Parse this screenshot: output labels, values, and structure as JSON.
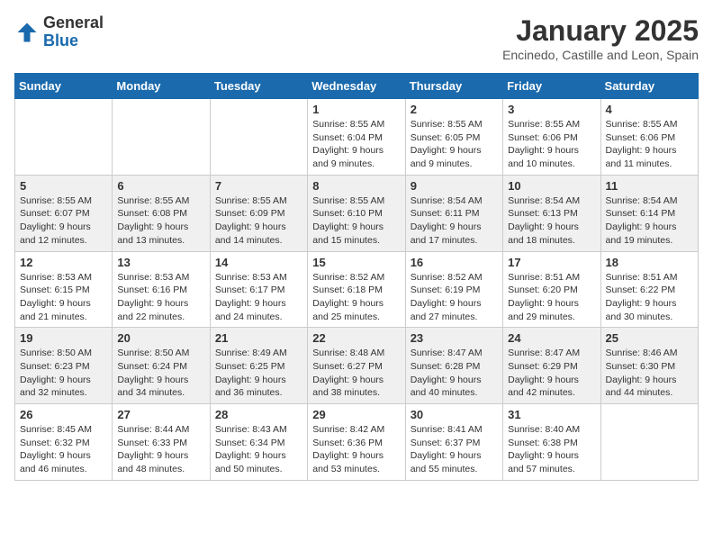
{
  "header": {
    "logo_line1": "General",
    "logo_line2": "Blue",
    "month": "January 2025",
    "location": "Encinedo, Castille and Leon, Spain"
  },
  "weekdays": [
    "Sunday",
    "Monday",
    "Tuesday",
    "Wednesday",
    "Thursday",
    "Friday",
    "Saturday"
  ],
  "weeks": [
    [
      {
        "day": "",
        "sunrise": "",
        "sunset": "",
        "daylight": ""
      },
      {
        "day": "",
        "sunrise": "",
        "sunset": "",
        "daylight": ""
      },
      {
        "day": "",
        "sunrise": "",
        "sunset": "",
        "daylight": ""
      },
      {
        "day": "1",
        "sunrise": "Sunrise: 8:55 AM",
        "sunset": "Sunset: 6:04 PM",
        "daylight": "Daylight: 9 hours and 9 minutes."
      },
      {
        "day": "2",
        "sunrise": "Sunrise: 8:55 AM",
        "sunset": "Sunset: 6:05 PM",
        "daylight": "Daylight: 9 hours and 9 minutes."
      },
      {
        "day": "3",
        "sunrise": "Sunrise: 8:55 AM",
        "sunset": "Sunset: 6:06 PM",
        "daylight": "Daylight: 9 hours and 10 minutes."
      },
      {
        "day": "4",
        "sunrise": "Sunrise: 8:55 AM",
        "sunset": "Sunset: 6:06 PM",
        "daylight": "Daylight: 9 hours and 11 minutes."
      }
    ],
    [
      {
        "day": "5",
        "sunrise": "Sunrise: 8:55 AM",
        "sunset": "Sunset: 6:07 PM",
        "daylight": "Daylight: 9 hours and 12 minutes."
      },
      {
        "day": "6",
        "sunrise": "Sunrise: 8:55 AM",
        "sunset": "Sunset: 6:08 PM",
        "daylight": "Daylight: 9 hours and 13 minutes."
      },
      {
        "day": "7",
        "sunrise": "Sunrise: 8:55 AM",
        "sunset": "Sunset: 6:09 PM",
        "daylight": "Daylight: 9 hours and 14 minutes."
      },
      {
        "day": "8",
        "sunrise": "Sunrise: 8:55 AM",
        "sunset": "Sunset: 6:10 PM",
        "daylight": "Daylight: 9 hours and 15 minutes."
      },
      {
        "day": "9",
        "sunrise": "Sunrise: 8:54 AM",
        "sunset": "Sunset: 6:11 PM",
        "daylight": "Daylight: 9 hours and 17 minutes."
      },
      {
        "day": "10",
        "sunrise": "Sunrise: 8:54 AM",
        "sunset": "Sunset: 6:13 PM",
        "daylight": "Daylight: 9 hours and 18 minutes."
      },
      {
        "day": "11",
        "sunrise": "Sunrise: 8:54 AM",
        "sunset": "Sunset: 6:14 PM",
        "daylight": "Daylight: 9 hours and 19 minutes."
      }
    ],
    [
      {
        "day": "12",
        "sunrise": "Sunrise: 8:53 AM",
        "sunset": "Sunset: 6:15 PM",
        "daylight": "Daylight: 9 hours and 21 minutes."
      },
      {
        "day": "13",
        "sunrise": "Sunrise: 8:53 AM",
        "sunset": "Sunset: 6:16 PM",
        "daylight": "Daylight: 9 hours and 22 minutes."
      },
      {
        "day": "14",
        "sunrise": "Sunrise: 8:53 AM",
        "sunset": "Sunset: 6:17 PM",
        "daylight": "Daylight: 9 hours and 24 minutes."
      },
      {
        "day": "15",
        "sunrise": "Sunrise: 8:52 AM",
        "sunset": "Sunset: 6:18 PM",
        "daylight": "Daylight: 9 hours and 25 minutes."
      },
      {
        "day": "16",
        "sunrise": "Sunrise: 8:52 AM",
        "sunset": "Sunset: 6:19 PM",
        "daylight": "Daylight: 9 hours and 27 minutes."
      },
      {
        "day": "17",
        "sunrise": "Sunrise: 8:51 AM",
        "sunset": "Sunset: 6:20 PM",
        "daylight": "Daylight: 9 hours and 29 minutes."
      },
      {
        "day": "18",
        "sunrise": "Sunrise: 8:51 AM",
        "sunset": "Sunset: 6:22 PM",
        "daylight": "Daylight: 9 hours and 30 minutes."
      }
    ],
    [
      {
        "day": "19",
        "sunrise": "Sunrise: 8:50 AM",
        "sunset": "Sunset: 6:23 PM",
        "daylight": "Daylight: 9 hours and 32 minutes."
      },
      {
        "day": "20",
        "sunrise": "Sunrise: 8:50 AM",
        "sunset": "Sunset: 6:24 PM",
        "daylight": "Daylight: 9 hours and 34 minutes."
      },
      {
        "day": "21",
        "sunrise": "Sunrise: 8:49 AM",
        "sunset": "Sunset: 6:25 PM",
        "daylight": "Daylight: 9 hours and 36 minutes."
      },
      {
        "day": "22",
        "sunrise": "Sunrise: 8:48 AM",
        "sunset": "Sunset: 6:27 PM",
        "daylight": "Daylight: 9 hours and 38 minutes."
      },
      {
        "day": "23",
        "sunrise": "Sunrise: 8:47 AM",
        "sunset": "Sunset: 6:28 PM",
        "daylight": "Daylight: 9 hours and 40 minutes."
      },
      {
        "day": "24",
        "sunrise": "Sunrise: 8:47 AM",
        "sunset": "Sunset: 6:29 PM",
        "daylight": "Daylight: 9 hours and 42 minutes."
      },
      {
        "day": "25",
        "sunrise": "Sunrise: 8:46 AM",
        "sunset": "Sunset: 6:30 PM",
        "daylight": "Daylight: 9 hours and 44 minutes."
      }
    ],
    [
      {
        "day": "26",
        "sunrise": "Sunrise: 8:45 AM",
        "sunset": "Sunset: 6:32 PM",
        "daylight": "Daylight: 9 hours and 46 minutes."
      },
      {
        "day": "27",
        "sunrise": "Sunrise: 8:44 AM",
        "sunset": "Sunset: 6:33 PM",
        "daylight": "Daylight: 9 hours and 48 minutes."
      },
      {
        "day": "28",
        "sunrise": "Sunrise: 8:43 AM",
        "sunset": "Sunset: 6:34 PM",
        "daylight": "Daylight: 9 hours and 50 minutes."
      },
      {
        "day": "29",
        "sunrise": "Sunrise: 8:42 AM",
        "sunset": "Sunset: 6:36 PM",
        "daylight": "Daylight: 9 hours and 53 minutes."
      },
      {
        "day": "30",
        "sunrise": "Sunrise: 8:41 AM",
        "sunset": "Sunset: 6:37 PM",
        "daylight": "Daylight: 9 hours and 55 minutes."
      },
      {
        "day": "31",
        "sunrise": "Sunrise: 8:40 AM",
        "sunset": "Sunset: 6:38 PM",
        "daylight": "Daylight: 9 hours and 57 minutes."
      },
      {
        "day": "",
        "sunrise": "",
        "sunset": "",
        "daylight": ""
      }
    ]
  ]
}
